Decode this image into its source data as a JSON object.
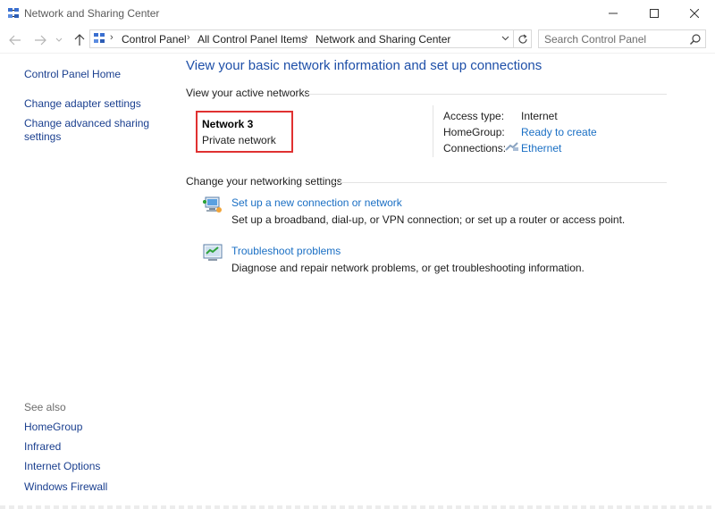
{
  "window": {
    "title": "Network and Sharing Center"
  },
  "address": {
    "crumbs": [
      "Control Panel",
      "All Control Panel Items",
      "Network and Sharing Center"
    ],
    "search_placeholder": "Search Control Panel"
  },
  "left_nav": {
    "home": "Control Panel Home",
    "adapter": "Change adapter settings",
    "advanced": "Change advanced sharing settings"
  },
  "see_also": {
    "label": "See also",
    "items": [
      "HomeGroup",
      "Infrared",
      "Internet Options",
      "Windows Firewall"
    ]
  },
  "main": {
    "heading": "View your basic network information and set up connections",
    "active_label": "View your active networks",
    "network_name": "Network  3",
    "network_type": "Private network",
    "access_type_label": "Access type:",
    "access_type_value": "Internet",
    "homegroup_label": "HomeGroup:",
    "homegroup_value": "Ready to create",
    "connections_label": "Connections:",
    "connections_value": "Ethernet",
    "change_label": "Change your networking settings",
    "tasks": [
      {
        "title": "Set up a new connection or network",
        "desc": "Set up a broadband, dial-up, or VPN connection; or set up a router or access point.",
        "icon": "new-connection-icon"
      },
      {
        "title": "Troubleshoot problems",
        "desc": "Diagnose and repair network problems, or get troubleshooting information.",
        "icon": "troubleshoot-icon"
      }
    ]
  },
  "colors": {
    "link": "#1a6fc4",
    "heading": "#1e4fa8",
    "highlight_box": "#e03131"
  }
}
